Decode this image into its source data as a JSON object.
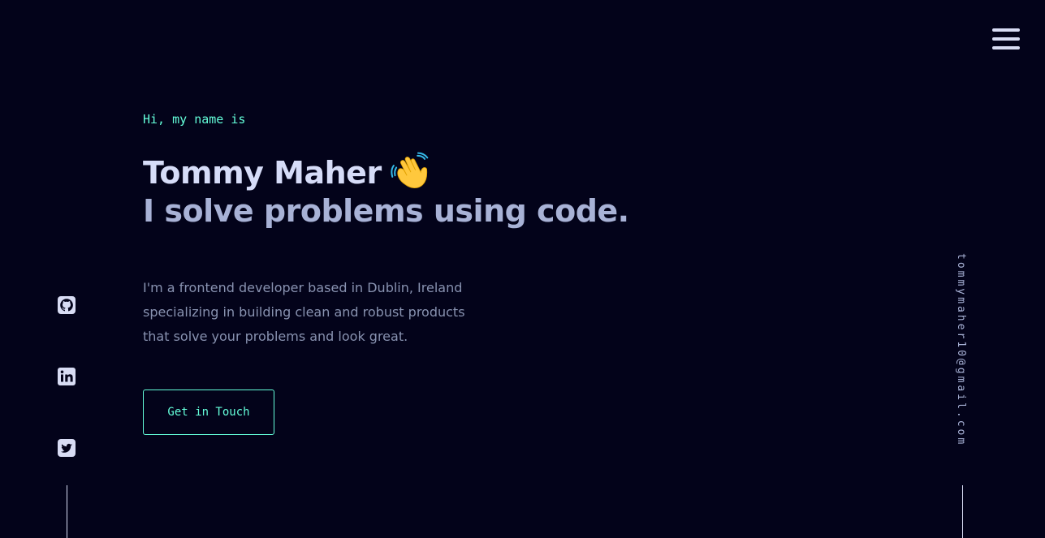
{
  "header": {
    "menu_icon": "hamburger-menu-icon"
  },
  "hero": {
    "greeting": "Hi, my name is",
    "name": "Tommy Maher",
    "name_icon": "waving-hand-icon",
    "tagline": "I solve problems using code.",
    "bio_lines": [
      "I'm a frontend developer based in Dublin, Ireland",
      "specializing in building clean and robust products",
      "that solve your problems and look great."
    ],
    "cta_label": "Get in Touch"
  },
  "social": {
    "icons": [
      "github-icon",
      "linkedin-icon",
      "twitter-icon"
    ]
  },
  "side": {
    "email": "tommymaher10@gmail.com"
  },
  "colors": {
    "background": "#03031a",
    "accent": "#64ffda",
    "heading": "#d6dcf8",
    "subheading": "#a8b2d6",
    "body_text": "#8892b0"
  }
}
